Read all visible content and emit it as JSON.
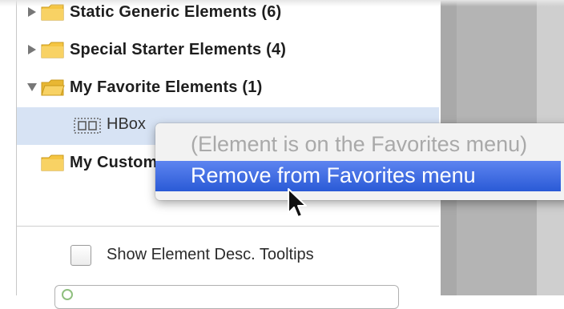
{
  "tree": {
    "rows": [
      {
        "label": "Static Generic Elements (6)",
        "expanded": false
      },
      {
        "label": "Special Starter Elements (4)",
        "expanded": false
      },
      {
        "label": "My Favorite Elements (1)",
        "expanded": true
      },
      {
        "label": "My Custom Elements",
        "expanded": false
      }
    ],
    "hbox_label": "HBox",
    "folder_color": "#f5c542"
  },
  "options": {
    "show_tooltips_label": "Show Element Desc. Tooltips",
    "show_tooltips_checked": false
  },
  "context_menu": {
    "info_label": "(Element is on the Favorites menu)",
    "remove_label": "Remove from Favorites menu",
    "highlight_color": "#3b6be0"
  }
}
